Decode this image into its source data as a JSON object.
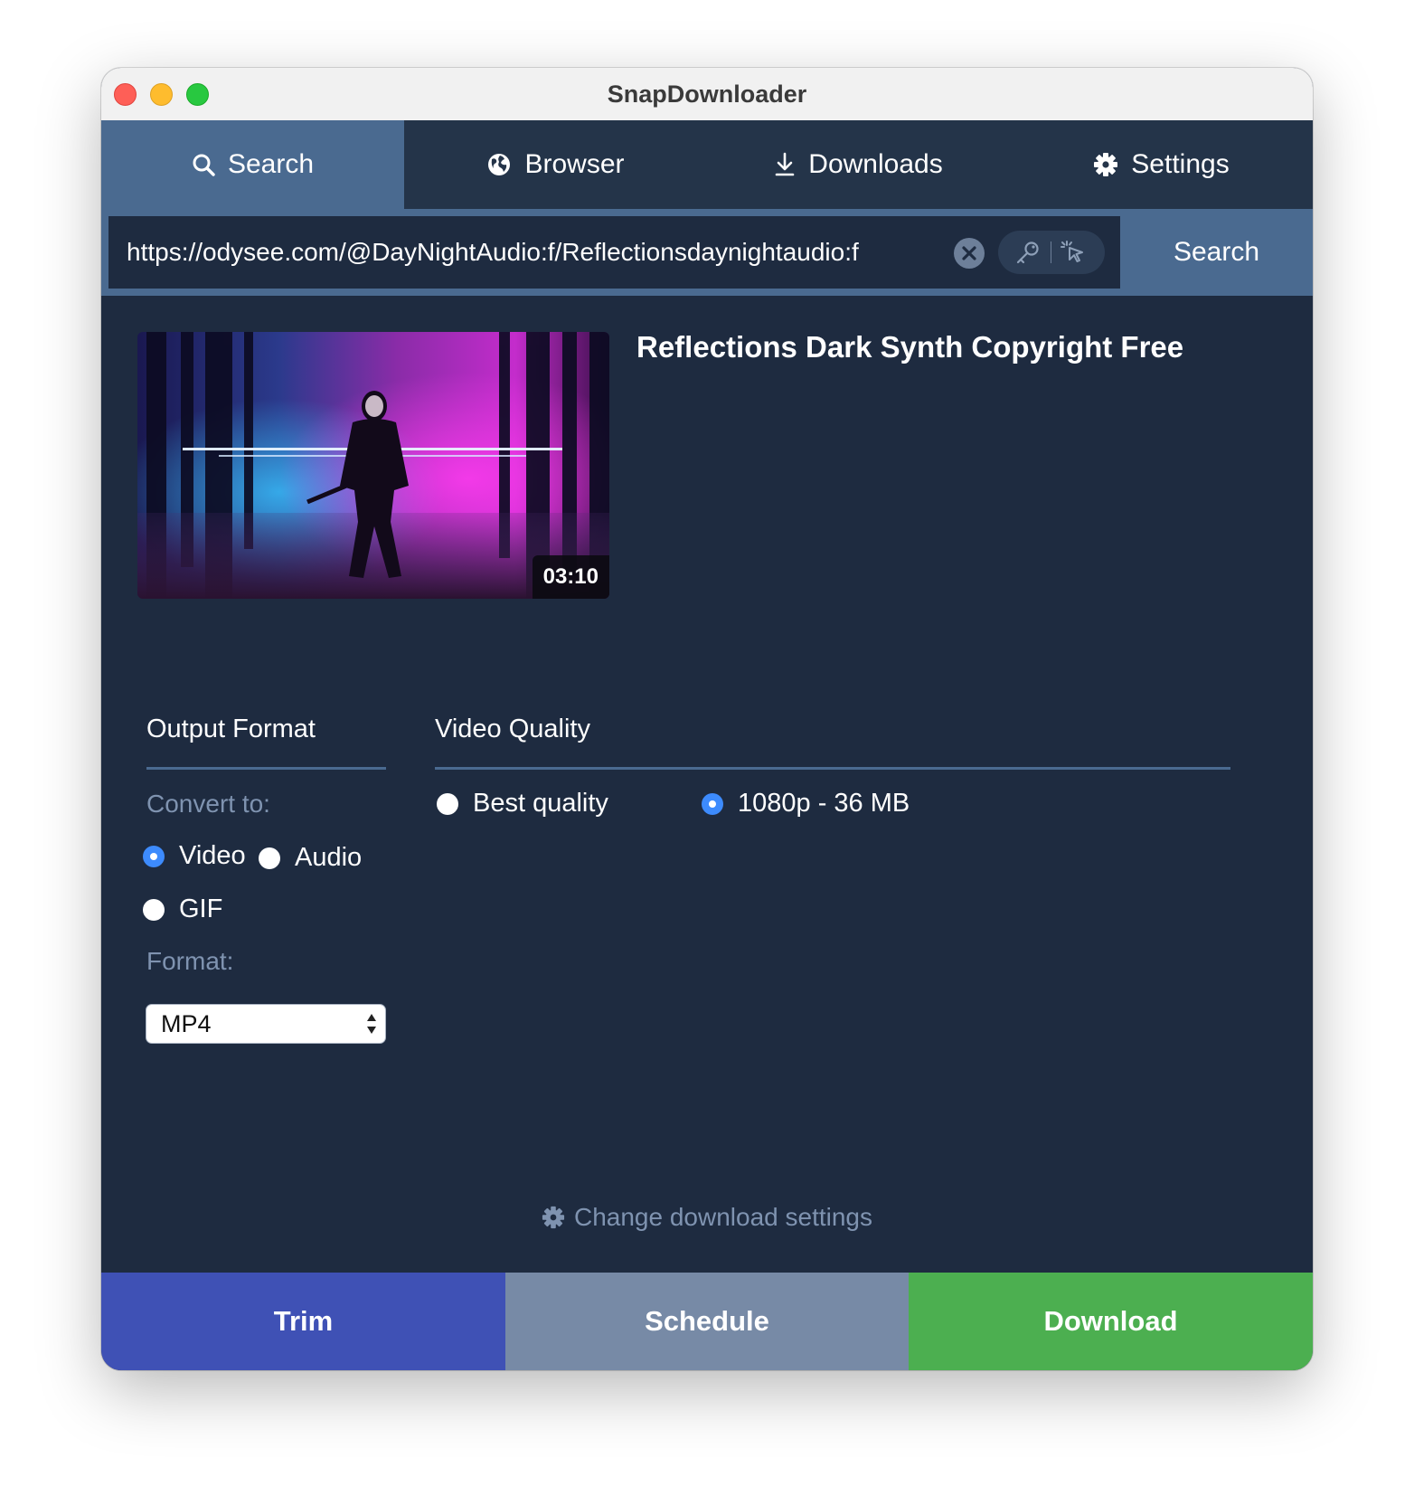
{
  "window": {
    "title": "SnapDownloader"
  },
  "tabs": [
    {
      "label": "Search",
      "icon": "search-icon",
      "active": true
    },
    {
      "label": "Browser",
      "icon": "globe-icon",
      "active": false
    },
    {
      "label": "Downloads",
      "icon": "download-icon",
      "active": false
    },
    {
      "label": "Settings",
      "icon": "gear-icon",
      "active": false
    }
  ],
  "search": {
    "url": "https://odysee.com/@DayNightAudio:f/Reflectionsdaynightaudio:f",
    "button_label": "Search"
  },
  "video": {
    "title": "Reflections Dark Synth Copyright Free",
    "duration": "03:10"
  },
  "output_format": {
    "heading": "Output Format",
    "convert_label": "Convert to:",
    "options": [
      {
        "label": "Video",
        "selected": true
      },
      {
        "label": "Audio",
        "selected": false
      },
      {
        "label": "GIF",
        "selected": false
      }
    ],
    "format_label": "Format:",
    "format_value": "MP4"
  },
  "video_quality": {
    "heading": "Video Quality",
    "options": [
      {
        "label": "Best quality",
        "selected": false
      },
      {
        "label": "1080p - 36 MB",
        "selected": true
      }
    ]
  },
  "change_settings_label": "Change download settings",
  "actions": {
    "trim": "Trim",
    "schedule": "Schedule",
    "download": "Download"
  },
  "colors": {
    "background": "#1e2b40",
    "tab_bar": "#243449",
    "accent": "#4a6a90",
    "trim": "#3f51b5",
    "schedule": "#778aa6",
    "download": "#4caf50",
    "radio_selected": "#3d8bfd"
  }
}
